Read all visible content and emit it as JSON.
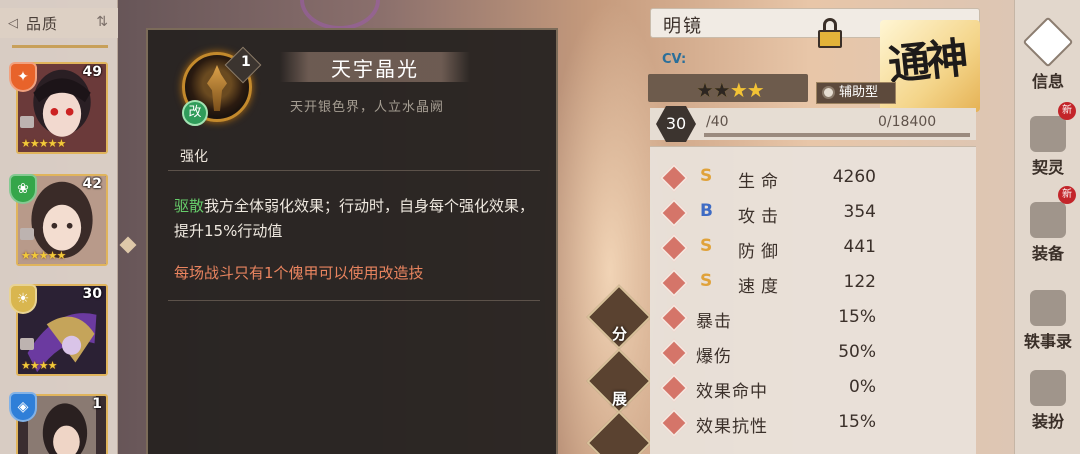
{
  "roster": {
    "sort_label": "品质",
    "cards": [
      {
        "level": "49",
        "stars": "★★★★★",
        "element": "fire",
        "color": "#e8632a"
      },
      {
        "level": "42",
        "stars": "★★★★★",
        "element": "wind",
        "color": "#35a64a"
      },
      {
        "level": "30",
        "stars": "★★★★",
        "element": "light",
        "color": "#d9b64f"
      },
      {
        "level": "1",
        "stars": "",
        "element": "water",
        "color": "#2f7fd8"
      }
    ]
  },
  "skill": {
    "number": "1",
    "badge": "改",
    "name": "天宇晶光",
    "subtitle": "天开银色界，人立水晶阙",
    "kind": "强化",
    "desc_keyword": "驱散",
    "desc_rest": "我方全体弱化效果；行动时，自身每个强化效果，提升15%行动值",
    "note": "每场战斗只有1个傀甲可以使用改造技"
  },
  "mid_buttons": [
    "分",
    "展"
  ],
  "hero": {
    "name": "明镜",
    "cv": "CV:",
    "stars_on": "★★★★",
    "stars_off": "★★",
    "role": "辅助型",
    "seal_text": "通神",
    "level": "30",
    "level_max": "/40",
    "exp": "0/18400"
  },
  "stats": [
    {
      "grade": "S",
      "name": "生命",
      "value": "4260"
    },
    {
      "grade": "B",
      "name": "攻击",
      "value": "354"
    },
    {
      "grade": "S",
      "name": "防御",
      "value": "441"
    },
    {
      "grade": "S",
      "name": "速度",
      "value": "122"
    },
    {
      "grade": "",
      "name": "暴击",
      "value": "15%"
    },
    {
      "grade": "",
      "name": "爆伤",
      "value": "50%"
    },
    {
      "grade": "",
      "name": "效果命中",
      "value": "0%"
    },
    {
      "grade": "",
      "name": "效果抗性",
      "value": "15%"
    }
  ],
  "nav": [
    {
      "label": "信息",
      "new": ""
    },
    {
      "label": "契灵",
      "new": "新"
    },
    {
      "label": "装备",
      "new": "新"
    },
    {
      "label": "轶事录",
      "new": ""
    },
    {
      "label": "装扮",
      "new": ""
    }
  ]
}
